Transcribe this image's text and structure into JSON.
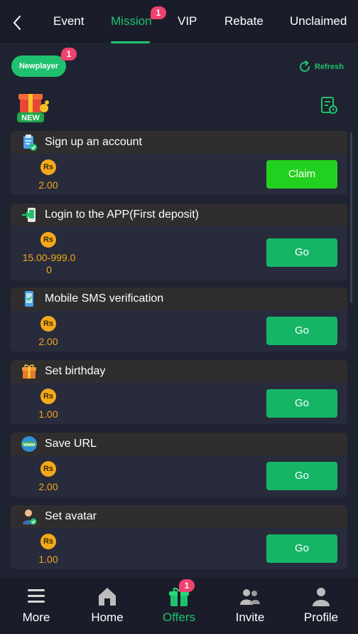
{
  "tabs": [
    {
      "label": "Event",
      "active": false
    },
    {
      "label": "Mission",
      "active": true,
      "badge": "1"
    },
    {
      "label": "VIP",
      "active": false
    },
    {
      "label": "Rebate",
      "active": false
    },
    {
      "label": "Unclaimed",
      "active": false
    }
  ],
  "subheader": {
    "newplayer_label": "Newplayer",
    "newplayer_badge": "1",
    "refresh_label": "Refresh",
    "new_tag": "NEW"
  },
  "coin_symbol": "Rs",
  "tasks": [
    {
      "title": "Sign up an account",
      "icon": "clipboard-check-icon",
      "reward": "2.00",
      "action": "Claim"
    },
    {
      "title": "Login to the APP(First deposit)",
      "icon": "login-arrow-icon",
      "reward_line1": "15.00-999.0",
      "reward_line2": "0",
      "action": "Go"
    },
    {
      "title": "Mobile SMS verification",
      "icon": "phone-verify-icon",
      "reward": "2.00",
      "action": "Go"
    },
    {
      "title": "Set birthday",
      "icon": "gift-icon",
      "reward": "1.00",
      "action": "Go"
    },
    {
      "title": "Save URL",
      "icon": "www-globe-icon",
      "reward": "2.00",
      "action": "Go"
    },
    {
      "title": "Set avatar",
      "icon": "user-avatar-icon",
      "reward": "1.00",
      "action": "Go"
    }
  ],
  "nav": [
    {
      "label": "More",
      "icon": "menu-icon",
      "active": false
    },
    {
      "label": "Home",
      "icon": "home-icon",
      "active": false
    },
    {
      "label": "Offers",
      "icon": "gift-icon",
      "active": true,
      "badge": "1"
    },
    {
      "label": "Invite",
      "icon": "users-icon",
      "active": false
    },
    {
      "label": "Profile",
      "icon": "profile-icon",
      "active": false
    }
  ],
  "colors": {
    "accent": "#1fc16e",
    "claim": "#22d11f",
    "coin": "#f5a81b",
    "badge": "#f0426f"
  }
}
